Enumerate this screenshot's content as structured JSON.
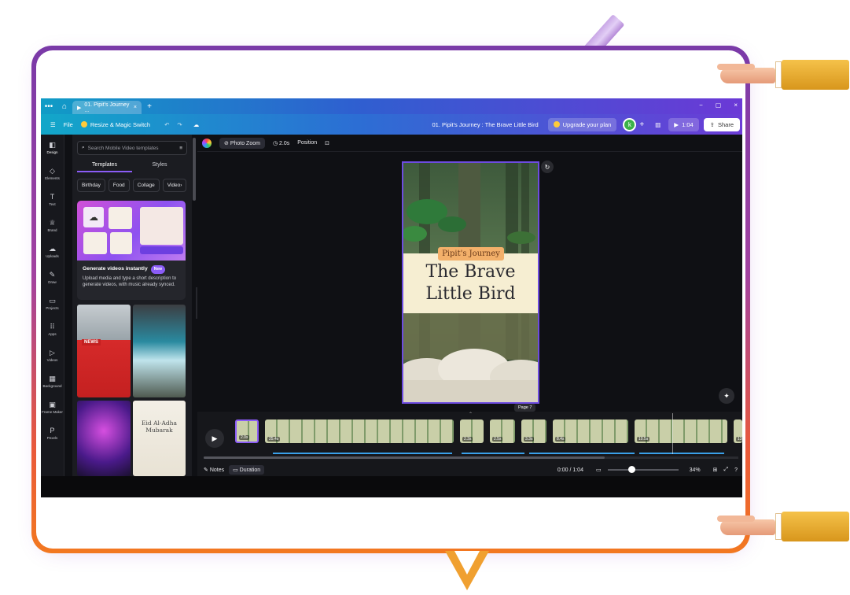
{
  "browser": {
    "tab_title": "01. Pipit's Journey ...",
    "menu_label": "•••",
    "home_icon": "home-icon",
    "new_tab": "+",
    "window_min": "−",
    "window_max": "▢",
    "window_close": "×"
  },
  "toolbar": {
    "menu_label": "☰",
    "file_label": "File",
    "resize_label": "Resize & Magic Switch",
    "undo_label": "↶",
    "redo_label": "↷",
    "cloud_icon": "☁",
    "doc_title": "01. Pipit's Journey : The Brave Little Bird",
    "upgrade_label": "Upgrade your plan",
    "avatar_letter": "k",
    "add_label": "+",
    "stats_icon": "📊",
    "play_time": "1:04",
    "share_label": "Share"
  },
  "rail": {
    "items": [
      {
        "label": "Design",
        "icon": "◧"
      },
      {
        "label": "Elements",
        "icon": "◇"
      },
      {
        "label": "Text",
        "icon": "T"
      },
      {
        "label": "Brand",
        "icon": "♕"
      },
      {
        "label": "Uploads",
        "icon": "☁"
      },
      {
        "label": "Draw",
        "icon": "✎"
      },
      {
        "label": "Projects",
        "icon": "▭"
      },
      {
        "label": "Apps",
        "icon": "⠿"
      },
      {
        "label": "Videos",
        "icon": "▷"
      },
      {
        "label": "Background",
        "icon": "▦"
      },
      {
        "label": "Frame Maker",
        "icon": "▣"
      },
      {
        "label": "Pexels",
        "icon": "P"
      }
    ]
  },
  "panel": {
    "search_placeholder": "Search Mobile Video templates",
    "tabs": [
      "Templates",
      "Styles"
    ],
    "chips": [
      "Birthday",
      "Food",
      "Collage",
      "Video"
    ],
    "gen_title": "Generate videos instantly",
    "gen_badge": "New",
    "gen_desc": "Upload media and type a short description to generate videos, with music already synced.",
    "thumb_news_label": "NEWS",
    "thumb_eid_title": "Eid Al-Adha Mubarak"
  },
  "canvas_toolbar": {
    "photo_zoom": "Photo Zoom",
    "duration": "2.0s",
    "position": "Position"
  },
  "design": {
    "subtitle": "Pipit's Journey",
    "title_line1": "The Brave",
    "title_line2": "Little Bird"
  },
  "timeline": {
    "clips": [
      {
        "label": "2.0s"
      },
      {
        "label": "25.4s"
      },
      {
        "label": "2.3s"
      },
      {
        "label": "2.5s"
      },
      {
        "label": "3.3s"
      },
      {
        "label": "8.4s"
      },
      {
        "label": "10.5s"
      },
      {
        "label": "13"
      }
    ],
    "page_tag": "Page 7"
  },
  "status": {
    "notes_label": "Notes",
    "duration_label": "Duration",
    "time": "0:00 / 1:04",
    "zoom": "34%",
    "zoom_fraction": 0.34
  },
  "colors": {
    "accent": "#8b5cf6",
    "frame_top": "#7a3aa8",
    "frame_bottom": "#f27820",
    "cuff": "#f0b43a"
  }
}
